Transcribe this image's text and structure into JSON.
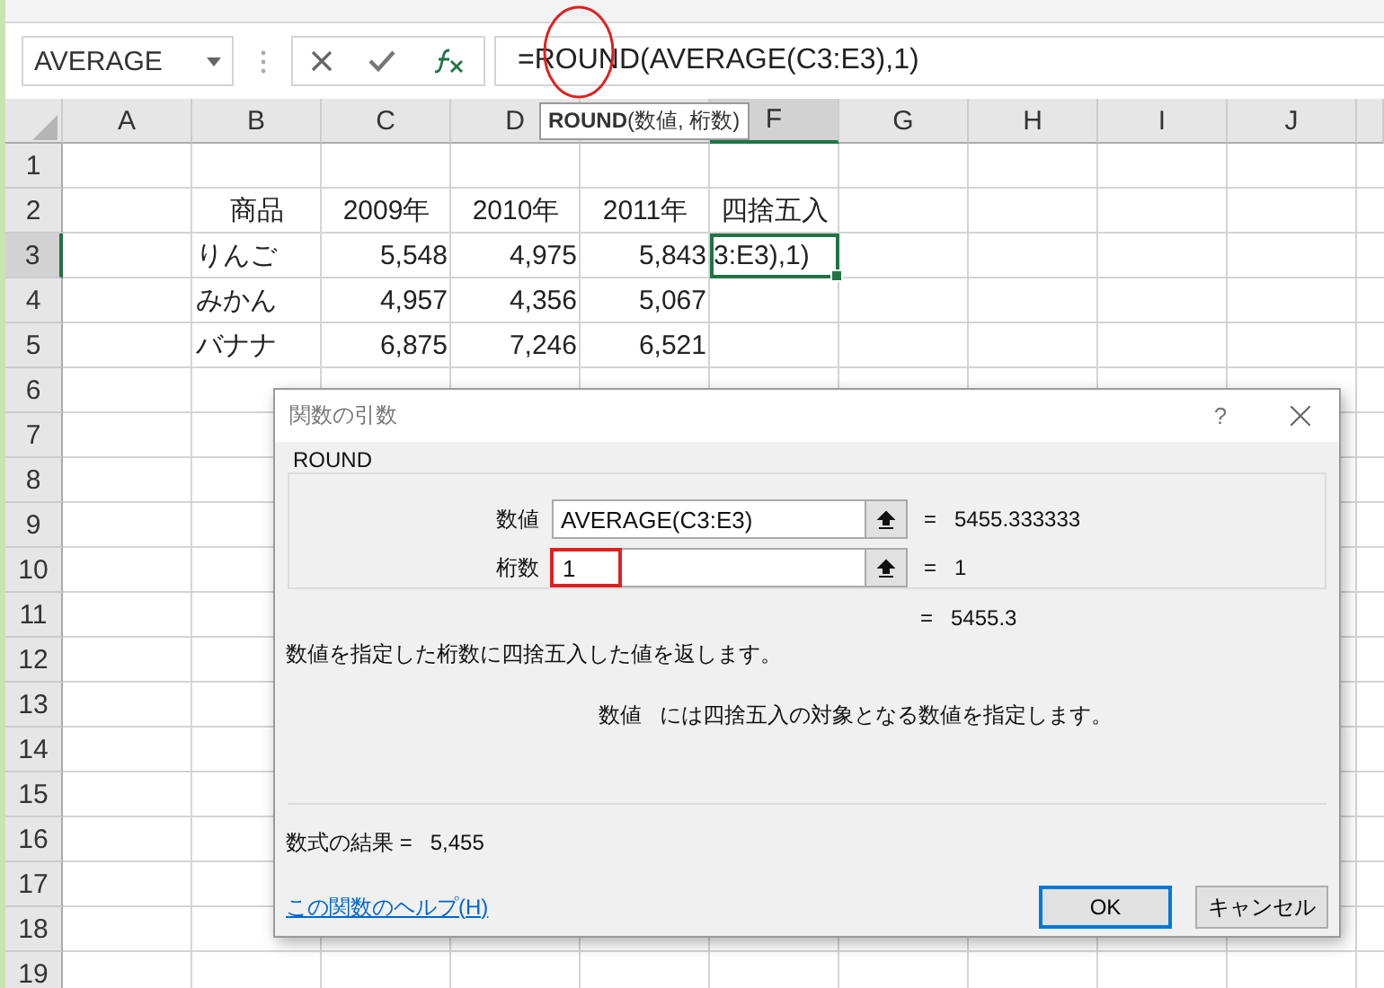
{
  "name_box": {
    "value": "AVERAGE"
  },
  "formula_bar": {
    "formula": "=ROUND(AVERAGE(C3:E3),1)"
  },
  "tooltip": {
    "text": "**ROUND**(数値, 桁数)"
  },
  "columns": [
    {
      "label": "A",
      "selected": false
    },
    {
      "label": "B",
      "selected": false
    },
    {
      "label": "C",
      "selected": false
    },
    {
      "label": "D",
      "selected": false
    },
    {
      "selected": false
    },
    {
      "label": "F",
      "selected": true
    },
    {
      "label": "G",
      "selected": false
    },
    {
      "label": "H",
      "selected": false
    },
    {
      "label": "I",
      "selected": false
    },
    {
      "label": "J",
      "selected": false
    }
  ],
  "rows": [
    {
      "header": "1",
      "selected": false,
      "cells": []
    },
    {
      "header": "2",
      "selected": false,
      "cells": [
        {
          "kind": "header",
          "text": "商品"
        },
        {
          "kind": "header",
          "text": "2009年"
        },
        {
          "kind": "header",
          "text": "2010年"
        },
        {
          "kind": "header",
          "text": "2011年"
        },
        {
          "kind": "header",
          "text": "四捨五入"
        }
      ]
    },
    {
      "header": "3",
      "selected": true,
      "cells": [
        {
          "kind": "label",
          "text": "りんご"
        },
        {
          "kind": "number",
          "text": "5,548"
        },
        {
          "kind": "number",
          "text": "4,975"
        },
        {
          "kind": "number",
          "text": "5,843"
        },
        {
          "kind": "editing",
          "text": "3:E3),1)"
        }
      ]
    },
    {
      "header": "4",
      "selected": false,
      "cells": [
        {
          "kind": "label",
          "text": "みかん"
        },
        {
          "kind": "number",
          "text": "4,957"
        },
        {
          "kind": "number",
          "text": "4,356"
        },
        {
          "kind": "number",
          "text": "5,067"
        }
      ]
    },
    {
      "header": "5",
      "selected": false,
      "cells": [
        {
          "kind": "label",
          "text": "バナナ"
        },
        {
          "kind": "number",
          "text": "6,875"
        },
        {
          "kind": "number",
          "text": "7,246"
        },
        {
          "kind": "number",
          "text": "6,521"
        }
      ]
    },
    {
      "header": "6",
      "selected": false,
      "cells": []
    },
    {
      "header": "7",
      "selected": false,
      "cells": []
    },
    {
      "header": "8",
      "selected": false,
      "cells": []
    },
    {
      "header": "9",
      "selected": false,
      "cells": []
    },
    {
      "header": "10",
      "selected": false,
      "cells": []
    },
    {
      "header": "11",
      "selected": false,
      "cells": []
    },
    {
      "header": "12",
      "selected": false,
      "cells": []
    },
    {
      "header": "13",
      "selected": false,
      "cells": []
    },
    {
      "header": "14",
      "selected": false,
      "cells": []
    },
    {
      "header": "15",
      "selected": false,
      "cells": []
    },
    {
      "header": "16",
      "selected": false,
      "cells": []
    },
    {
      "header": "17",
      "selected": false,
      "cells": []
    },
    {
      "header": "18",
      "selected": false,
      "cells": []
    },
    {
      "header": "19",
      "selected": false,
      "cells": []
    }
  ],
  "dialog": {
    "title": "関数の引数",
    "help": "?",
    "function_name": "ROUND",
    "arguments": [
      {
        "label": "数値",
        "value": "AVERAGE(C3:E3)",
        "result": "=   5455.333333",
        "highlighted": false
      },
      {
        "label": "桁数",
        "value": "1",
        "result": "=   1",
        "highlighted": true
      }
    ],
    "overall_result": "=   5455.3",
    "description": "数値を指定した桁数に四捨五入した値を返します。",
    "argument_help": {
      "name": "数値",
      "text": "には四捨五入の対象となる数値を指定します。"
    },
    "formula_result": {
      "label": "数式の結果 =",
      "value": "5,455"
    },
    "help_link": "この関数のヘルプ(H)",
    "buttons": [
      {
        "label": "OK",
        "default": true
      },
      {
        "label": "キャンセル",
        "default": false
      }
    ]
  }
}
